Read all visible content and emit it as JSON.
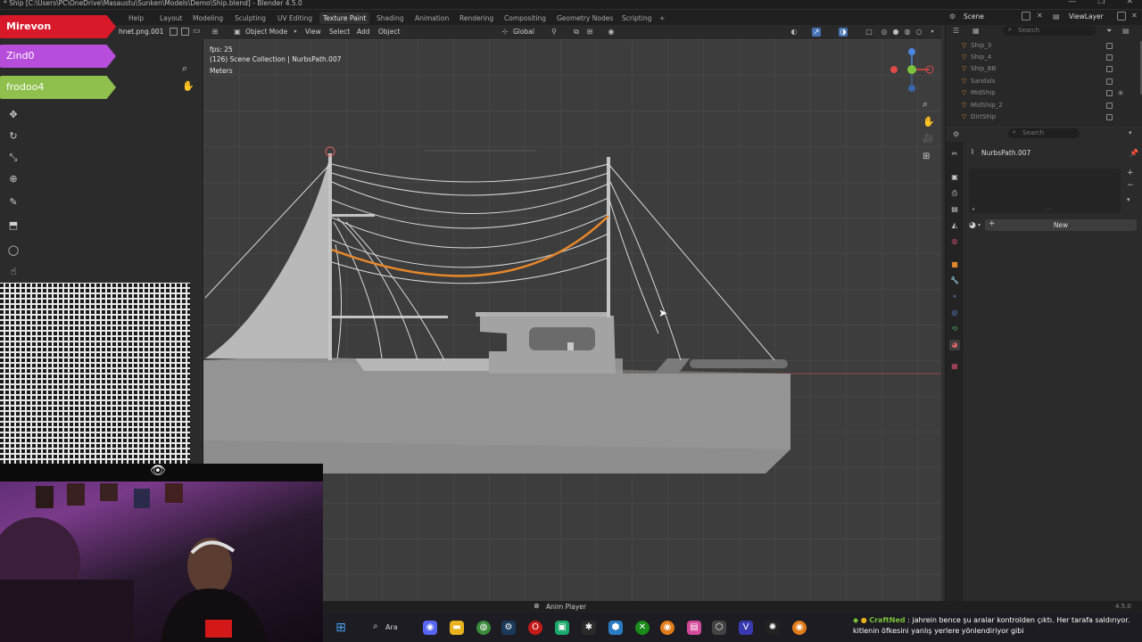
{
  "window": {
    "title": "* Ship [C:\\Users\\PC\\OneDrive\\Masaustu\\Sunken\\Models\\Demo\\Ship.blend] - Blender 4.5.0",
    "controls": [
      "—",
      "❐",
      "✕"
    ]
  },
  "menubar": {
    "help": "Help",
    "workspaces": [
      "Layout",
      "Modeling",
      "Sculpting",
      "UV Editing",
      "Texture Paint",
      "Shading",
      "Animation",
      "Rendering",
      "Compositing",
      "Geometry Nodes",
      "Scripting"
    ],
    "active_workspace": "Texture Paint",
    "add_tab": "+",
    "scene_label": "Scene",
    "viewlayer_label": "ViewLayer"
  },
  "image_editor": {
    "image_name": "hnet.png.001"
  },
  "stream_tags": [
    {
      "label": "Mirevon",
      "color": "#d8192a"
    },
    {
      "label": "Zind0",
      "color": "#b74ddb"
    },
    {
      "label": "frodoo4",
      "color": "#8fbf4c"
    }
  ],
  "viewport_header": {
    "mode": "Object Mode",
    "menus": [
      "View",
      "Select",
      "Add",
      "Object"
    ],
    "orientation": "Global"
  },
  "viewport_overlay": {
    "fps": "fps: 25",
    "collection": "(126) Scene Collection | NurbsPath.007",
    "units": "Meters"
  },
  "outliner": {
    "search_placeholder": "Search",
    "items": [
      "Ship_3",
      "Ship_4",
      "Ship_BB",
      "Sandals",
      "MidShip",
      "MidShip_2",
      "DirtShip"
    ]
  },
  "properties": {
    "search_placeholder": "Search",
    "object_name": "NurbsPath.007",
    "new_button": "New"
  },
  "statusbar": {
    "anim_player": "Anim Player",
    "version": "4.5.0"
  },
  "taskbar": {
    "search_label": "Ara"
  },
  "chat": {
    "user": "CraftNed",
    "message_line1": ": jahrein bence şu aralar kontrolden çıktı. Her tarafa saldırıyor.",
    "message_line2": "kitlenin öfkesini yanlış yerlere yönlendiriyor gibi"
  },
  "colors": {
    "accent": "#4772b3",
    "selected_curve": "#e8872a",
    "outliner_icon": "#d08a3a"
  },
  "icons": {
    "webcam_overlay": "eye-icon"
  }
}
